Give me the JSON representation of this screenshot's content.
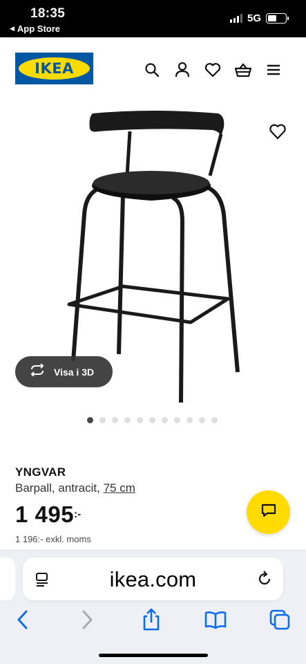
{
  "status_bar": {
    "time": "18:35",
    "back_app": "App Store",
    "network": "5G"
  },
  "header": {
    "logo_text": "IKEA",
    "icons": [
      "search-icon",
      "account-icon",
      "favourites-icon",
      "shopping-basket-icon",
      "menu-icon"
    ]
  },
  "product": {
    "name": "YNGVAR",
    "description": "Barpall, antracit,",
    "size": "75 cm",
    "price": "1 495",
    "price_suffix": ":-",
    "price_ex_vat": "1 196:- exkl. moms",
    "view_3d_label": "Visa i 3D",
    "image_count": 11,
    "active_image_index": 0
  },
  "browser": {
    "url": "ikea.com",
    "buttons": [
      "back-icon",
      "forward-icon",
      "share-icon",
      "bookmarks-icon",
      "tabs-icon"
    ]
  },
  "colors": {
    "ikea_blue": "#0058a3",
    "ikea_yellow": "#ffdb00",
    "safari_blue": "#0a6cf2"
  }
}
